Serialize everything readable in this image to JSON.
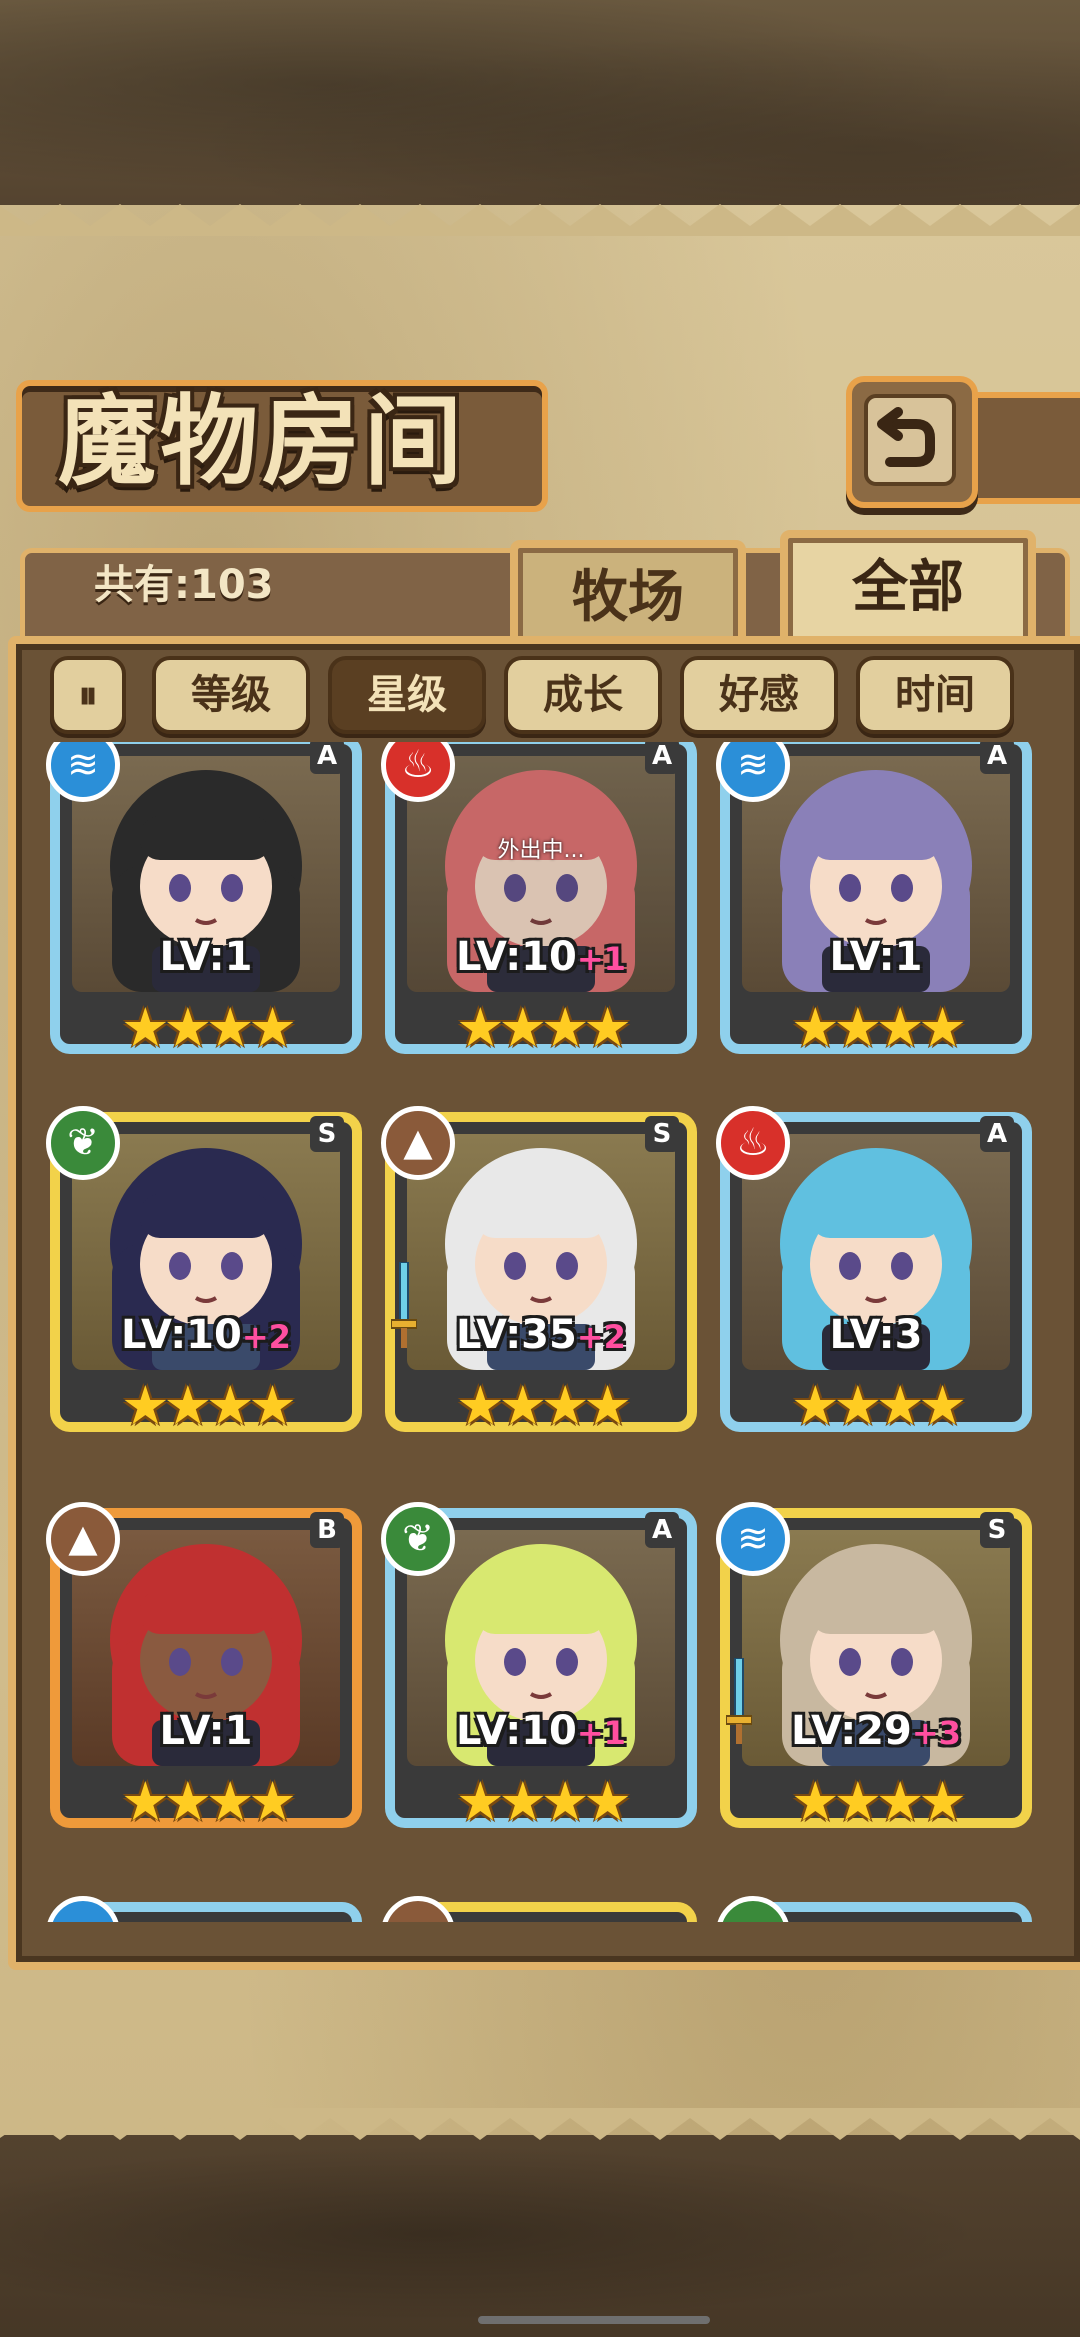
{
  "screen": {
    "title": "魔物房间",
    "count_text": "共有:103",
    "tabs": [
      {
        "label": "牧场",
        "active": false
      },
      {
        "label": "全部",
        "active": true
      }
    ],
    "filters": [
      {
        "label": "等级",
        "active": false
      },
      {
        "label": "星级",
        "active": true
      },
      {
        "label": "成长",
        "active": false
      },
      {
        "label": "好感",
        "active": false
      },
      {
        "label": "时间",
        "active": false
      }
    ],
    "sort_icon_glyph": "⏸"
  },
  "colors": {
    "frame_blue": "#8fd0ec",
    "frame_gold": "#f2d24a",
    "frame_orange": "#ef9a3a",
    "element_water": "#2b8fd8",
    "element_fire": "#d8302a",
    "element_wood": "#3a8a3a",
    "element_earth": "#8a5a3a"
  },
  "monsters": [
    {
      "rank": "A",
      "element": "water",
      "element_glyph": "≋",
      "frame": "blue",
      "lv": "LV:1",
      "plus": "",
      "stars": "★★★★",
      "away": ""
    },
    {
      "rank": "A",
      "element": "fire",
      "element_glyph": "♨",
      "frame": "blue",
      "lv": "LV:10",
      "plus": "+1",
      "stars": "★★★★",
      "away": "外出中..."
    },
    {
      "rank": "A",
      "element": "water",
      "element_glyph": "≋",
      "frame": "blue",
      "lv": "LV:1",
      "plus": "",
      "stars": "★★★★",
      "away": ""
    },
    {
      "rank": "S",
      "element": "wood",
      "element_glyph": "❦",
      "frame": "gold",
      "lv": "LV:10",
      "plus": "+2",
      "stars": "★★★★",
      "away": ""
    },
    {
      "rank": "S",
      "element": "earth",
      "element_glyph": "▲",
      "frame": "gold",
      "lv": "LV:35",
      "plus": "+2",
      "stars": "★★★★",
      "away": "",
      "sword": true
    },
    {
      "rank": "A",
      "element": "fire",
      "element_glyph": "♨",
      "frame": "blue",
      "lv": "LV:3",
      "plus": "",
      "stars": "★★★★",
      "away": ""
    },
    {
      "rank": "B",
      "element": "earth",
      "element_glyph": "▲",
      "frame": "orange",
      "lv": "LV:1",
      "plus": "",
      "stars": "★★★★",
      "away": ""
    },
    {
      "rank": "A",
      "element": "wood",
      "element_glyph": "❦",
      "frame": "blue",
      "lv": "LV:10",
      "plus": "+1",
      "stars": "★★★★",
      "away": ""
    },
    {
      "rank": "S",
      "element": "water",
      "element_glyph": "≋",
      "frame": "gold",
      "lv": "LV:29",
      "plus": "+3",
      "stars": "★★★★",
      "away": "",
      "sword": true
    }
  ],
  "partial_row": [
    {
      "element": "water",
      "frame": "blue"
    },
    {
      "element": "earth",
      "frame": "gold"
    },
    {
      "element": "wood",
      "frame": "blue"
    }
  ]
}
